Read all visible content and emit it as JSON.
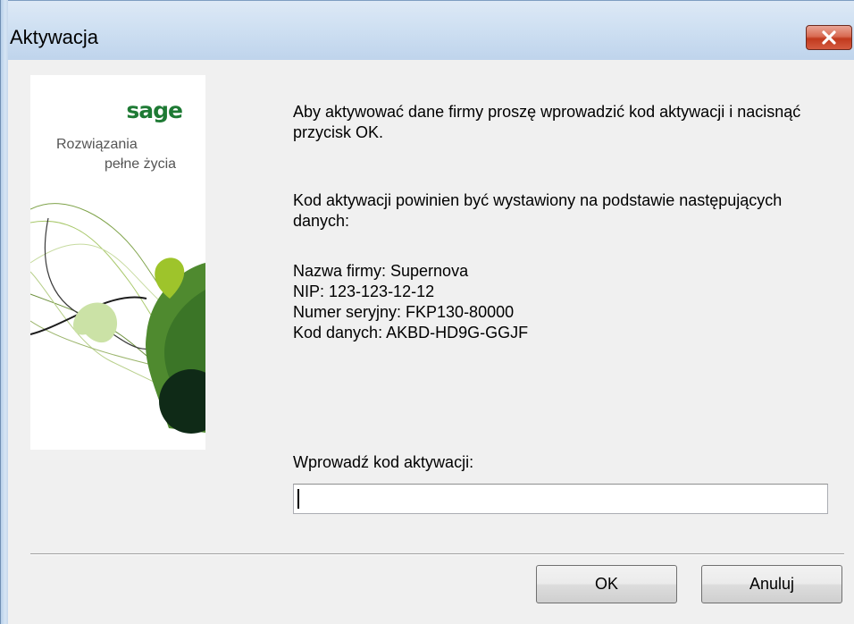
{
  "window": {
    "title": "Aktywacja",
    "close_icon": "close-icon"
  },
  "branding": {
    "logo": "sage",
    "tagline_line1": "Rozwiązania",
    "tagline_line2": "pełne życia"
  },
  "message": {
    "instruction": "Aby aktywować dane firmy proszę wprowadzić kod aktywacji i nacisnąć przycisk OK.",
    "basis": "Kod aktywacji powinien być wystawiony na podstawie następujących danych:"
  },
  "details": {
    "company_name": "Nazwa firmy: Supernova",
    "nip": "NIP: 123-123-12-12",
    "serial_number": "Numer seryjny: FKP130-80000",
    "data_code": "Kod danych: AKBD-HD9G-GGJF"
  },
  "activation": {
    "label": "Wprowadź kod aktywacji:",
    "value": "",
    "placeholder": ""
  },
  "buttons": {
    "ok": "OK",
    "cancel": "Anuluj"
  },
  "colors": {
    "brand_green": "#1e7a34",
    "close_red": "#c13a1e",
    "titlebar": "#cfe0f2"
  }
}
